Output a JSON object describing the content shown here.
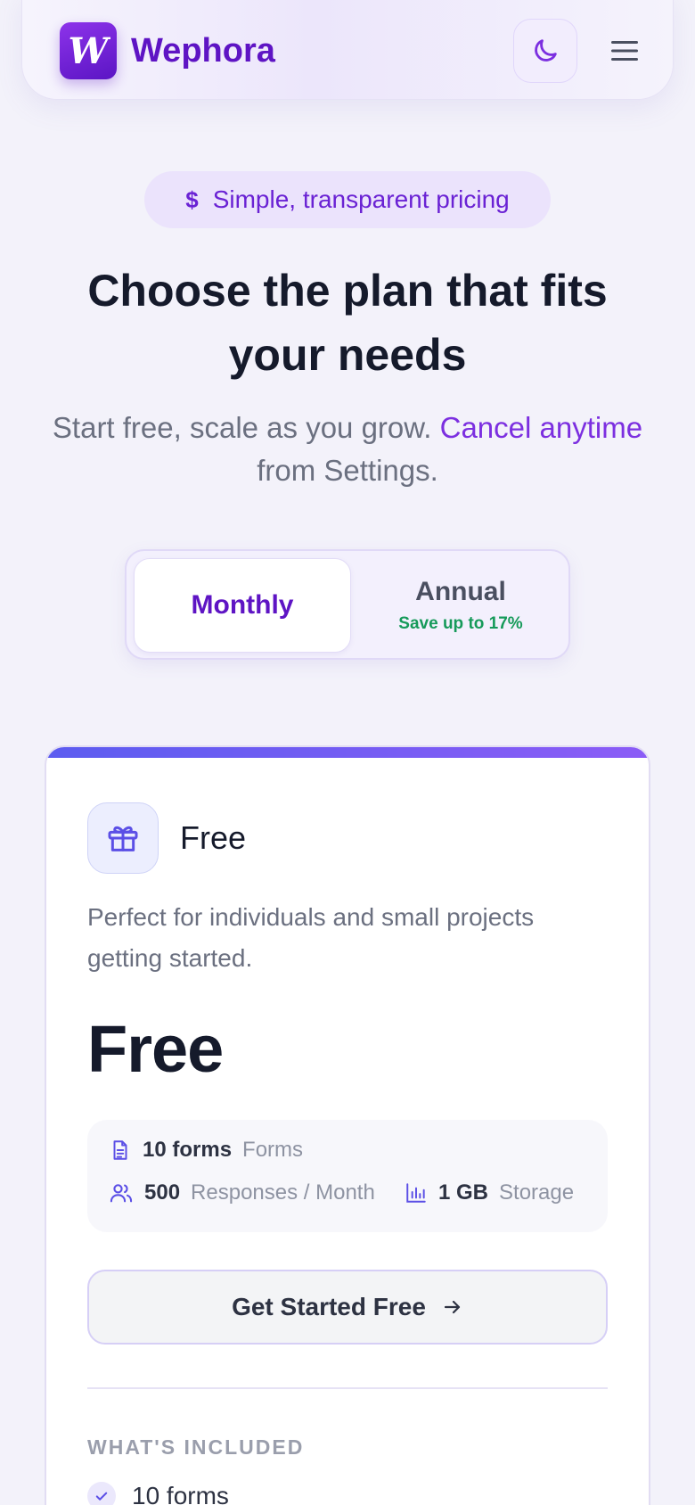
{
  "header": {
    "brand": "Wephora",
    "logo_letter": "W",
    "theme_toggle_icon": "moon-icon",
    "menu_icon": "hamburger-icon"
  },
  "hero": {
    "badge_icon": "$",
    "badge_text": "Simple, transparent pricing",
    "title": "Choose the plan that fits your needs",
    "subtitle_start": "Start free, scale as you grow.",
    "subtitle_link": "Cancel anytime",
    "subtitle_end": "from Settings."
  },
  "billing_toggle": {
    "monthly_label": "Monthly",
    "annual_label": "Annual",
    "annual_note": "Save up to 17%",
    "selected": "Monthly"
  },
  "plan": {
    "icon": "gift-icon",
    "name": "Free",
    "description": "Perfect for individuals and small projects getting started.",
    "price": "Free",
    "limits": {
      "forms_value": "10 forms",
      "forms_label": "Forms",
      "responses_value": "500",
      "responses_label": "Responses / Month",
      "storage_value": "1 GB",
      "storage_label": "Storage"
    },
    "cta_label": "Get Started Free",
    "included_heading": "WHAT'S INCLUDED",
    "features": [
      "10 forms"
    ]
  },
  "colors": {
    "brand": "#5e14c4",
    "accent": "#7c2fe0",
    "success": "#169a5a",
    "background": "#f3f2fa"
  }
}
